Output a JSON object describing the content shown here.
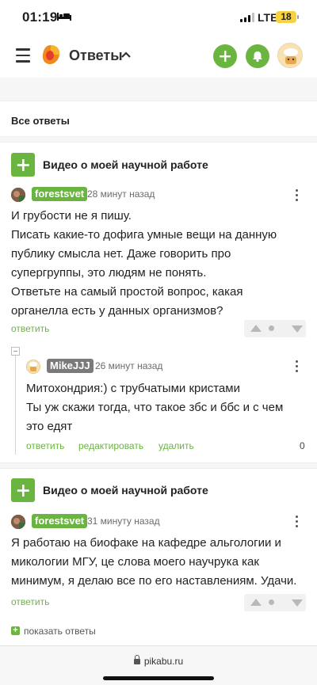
{
  "status_bar": {
    "time": "01:19",
    "network": "LTE",
    "battery": "18"
  },
  "header": {
    "title": "Ответы",
    "icons": [
      "menu-icon",
      "pikabu-logo",
      "chevron-up-icon",
      "plus-icon",
      "bell-icon",
      "avatar"
    ]
  },
  "section": {
    "title": "Все ответы"
  },
  "threads": [
    {
      "post_title": "Видео о моей научной работе",
      "comment": {
        "author": "forestsvet",
        "time": "28 минут назад",
        "text": [
          "И грубости не я пишу.",
          "Писать какие-то дофига умные вещи на данную",
          "публику смысла нет. Даже говорить про",
          "супергруппы, это людям не понять.",
          "Ответьте на самый простой вопрос, какая",
          "органелла есть у данных организмов?"
        ],
        "reply_label": "ответить"
      },
      "reply": {
        "author": "MikeJJJ",
        "time": "26 минут назад",
        "text": [
          "Митохондрия:) с трубчатыми кристами",
          "Ты уж скажи тогда, что такое збс и ббс и с чем",
          "это едят"
        ],
        "reply_label": "ответить",
        "edit_label": "редактировать",
        "delete_label": "удалить",
        "rating": "0"
      }
    },
    {
      "post_title": "Видео о моей научной работе",
      "comment": {
        "author": "forestsvet",
        "time": "31 минуту назад",
        "text": [
          "Я работаю на биофаке на кафедре альгологии и",
          "микологии МГУ, це слова моего научрука как",
          "минимум, я делаю все по его наставлениям. Удачи."
        ],
        "reply_label": "ответить"
      },
      "show_replies_label": "показать ответы"
    }
  ],
  "browser": {
    "url": "pikabu.ru"
  },
  "colors": {
    "accent": "#6ab540",
    "nick_gray": "#7a7a7a",
    "battery": "#f6d23f"
  }
}
